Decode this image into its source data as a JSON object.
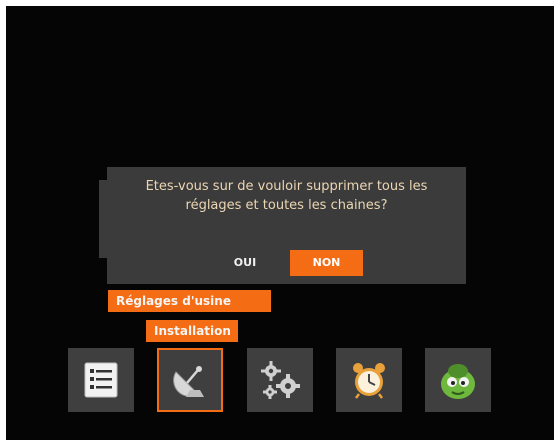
{
  "dialog": {
    "message_line1": "Etes-vous sur de vouloir supprimer tous les",
    "message_line2": "réglages et toutes les chaines?",
    "buttons": {
      "yes_label": "OUI",
      "no_label": "NON"
    }
  },
  "menu": {
    "submenu_item": "Réglages d'usine",
    "category_item": "Installation"
  },
  "main_icons": [
    {
      "name": "channel-list-icon"
    },
    {
      "name": "satellite-dish-icon",
      "selected": true
    },
    {
      "name": "gears-icon"
    },
    {
      "name": "alarm-clock-icon"
    },
    {
      "name": "game-character-icon"
    }
  ],
  "colors": {
    "accent": "#f46c14",
    "background": "#050505",
    "panel": "#3b3b3b"
  }
}
